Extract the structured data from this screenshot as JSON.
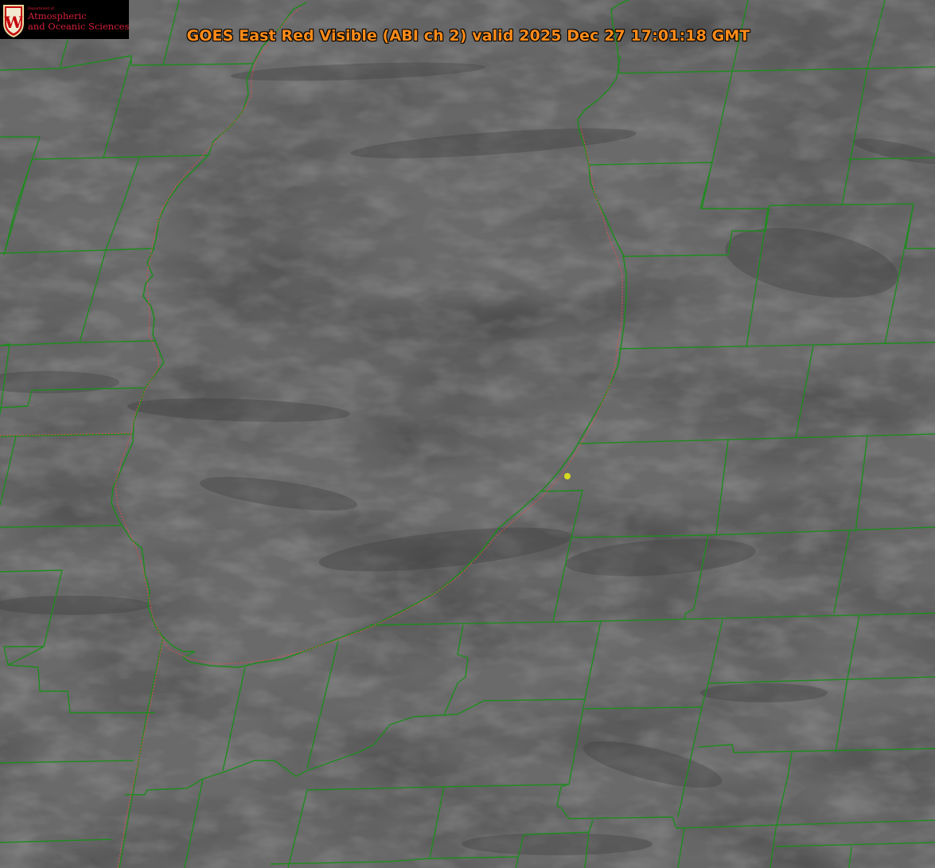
{
  "header": {
    "title": "GOES East Red Visible (ABI ch 2) valid 2025 Dec 27 17:01:18 GMT"
  },
  "logo": {
    "dept_small": "Department of",
    "line1": "Atmospheric",
    "line2": "and Oceanic Sciences",
    "crest_letter": "W"
  },
  "map": {
    "station_marker": "yellow-dot"
  },
  "colors": {
    "title": "#ff8c1a",
    "logo_text": "#d6203a",
    "county_lines": "#1e8c1e",
    "coastline_dash": "#e05050",
    "marker": "#d8d820",
    "background": "#666666"
  }
}
